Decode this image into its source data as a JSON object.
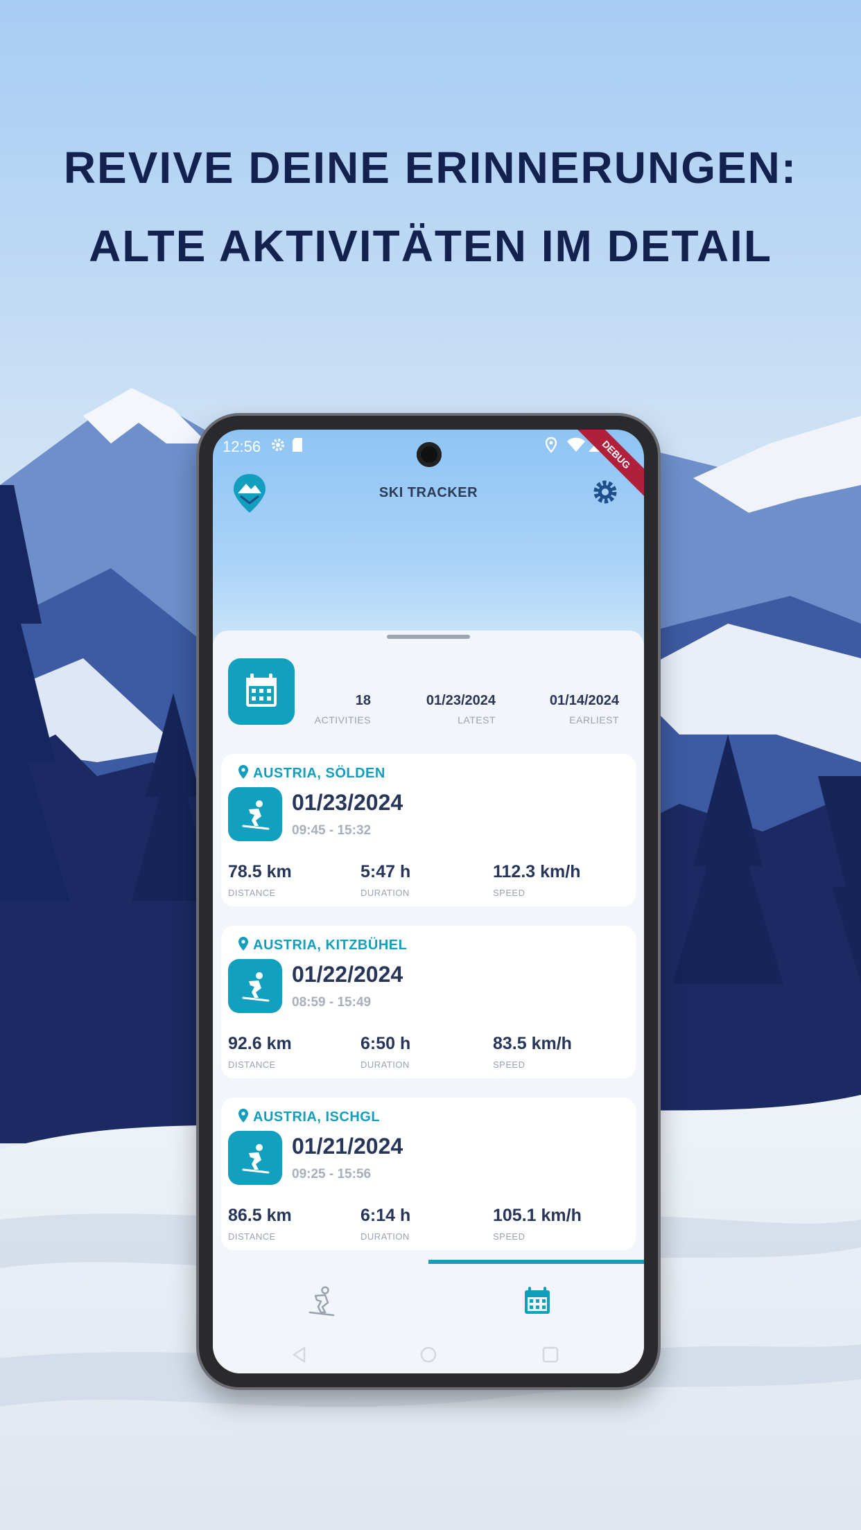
{
  "headline": {
    "line1": "REVIVE DEINE ERINNERUNGEN:",
    "line2": "ALTE AKTIVITÄTEN IM DETAIL"
  },
  "status_bar": {
    "time": "12:56",
    "debug_banner": "DEBUG"
  },
  "app_bar": {
    "title": "SKI TRACKER"
  },
  "summary": {
    "activities_value": "18",
    "activities_label": "ACTIVITIES",
    "latest_value": "01/23/2024",
    "latest_label": "LATEST",
    "earliest_value": "01/14/2024",
    "earliest_label": "EARLIEST"
  },
  "activities": [
    {
      "location": "AUSTRIA, SÖLDEN",
      "date": "01/23/2024",
      "time_range": "09:45 - 15:32",
      "distance": "78.5 km",
      "duration": "5:47 h",
      "speed": "112.3 km/h"
    },
    {
      "location": "AUSTRIA, KITZBÜHEL",
      "date": "01/22/2024",
      "time_range": "08:59 - 15:49",
      "distance": "92.6 km",
      "duration": "6:50 h",
      "speed": "83.5 km/h"
    },
    {
      "location": "AUSTRIA, ISCHGL",
      "date": "01/21/2024",
      "time_range": "09:25 - 15:56",
      "distance": "86.5 km",
      "duration": "6:14 h",
      "speed": "105.1 km/h"
    }
  ],
  "labels": {
    "distance": "DISTANCE",
    "duration": "DURATION",
    "speed": "SPEED"
  },
  "colors": {
    "accent": "#129ebd",
    "headline": "#13214f",
    "card_text": "#27355a"
  },
  "icons": {
    "logo": "mountain-pin-logo-icon",
    "settings": "gear-icon",
    "summary": "calendar-icon",
    "activity": "skier-icon",
    "location": "location-pin-icon",
    "tab_track": "skier-icon",
    "tab_history": "calendar-icon"
  }
}
